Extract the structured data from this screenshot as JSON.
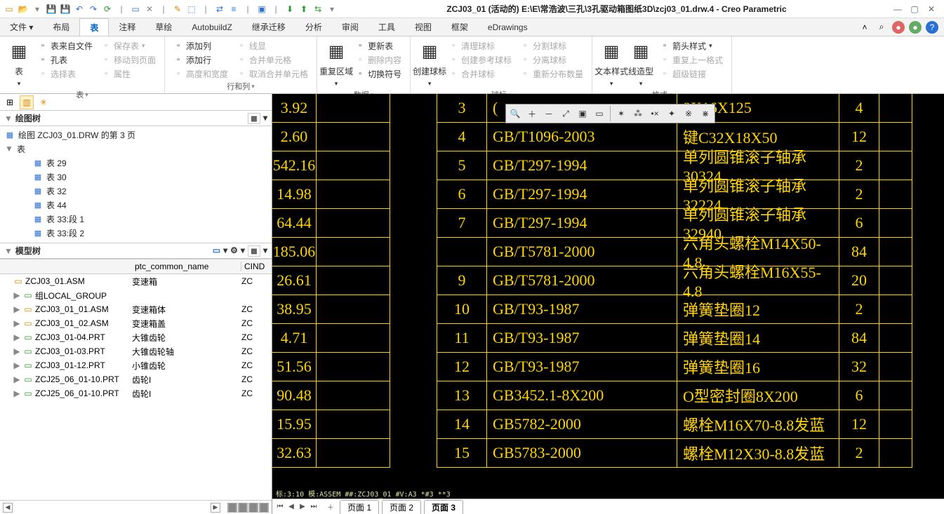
{
  "app_title": "ZCJ03_01 (活动的) E:\\E\\常浩波\\三孔\\3孔驱动箱图纸3D\\zcj03_01.drw.4 - Creo Parametric",
  "menus": [
    "文件",
    "布局",
    "表",
    "注释",
    "草绘",
    "AutobuildZ",
    "继承迁移",
    "分析",
    "审阅",
    "工具",
    "视图",
    "框架",
    "eDrawings"
  ],
  "active_menu_index": 2,
  "ribbon": {
    "groups": [
      {
        "label": "表",
        "items": [
          {
            "t": "表",
            "big": true
          },
          {
            "t": "表来自文件"
          },
          {
            "t": "孔表"
          },
          {
            "t": "选择表",
            "disabled": true
          },
          {
            "t": "保存表",
            "dd": true,
            "disabled": true
          },
          {
            "t": "移动到页面",
            "disabled": true
          },
          {
            "t": "属性",
            "disabled": true
          }
        ]
      },
      {
        "label": "行和列",
        "items": [
          {
            "t": "添加列"
          },
          {
            "t": "添加行"
          },
          {
            "t": "高度和宽度",
            "disabled": true
          },
          {
            "t": "线显",
            "disabled": true
          },
          {
            "t": "合并单元格",
            "disabled": true
          },
          {
            "t": "取消合并单元格",
            "disabled": true
          }
        ]
      },
      {
        "label": "数据",
        "items": [
          {
            "t": "重复区域",
            "big": true
          },
          {
            "t": "更新表"
          },
          {
            "t": "删除内容",
            "disabled": true
          },
          {
            "t": "切换符号"
          }
        ]
      },
      {
        "label": "球标",
        "items": [
          {
            "t": "创建球标",
            "big": true
          },
          {
            "t": "清理球标",
            "disabled": true
          },
          {
            "t": "创建参考球标",
            "disabled": true
          },
          {
            "t": "合并球标",
            "disabled": true
          },
          {
            "t": "分割球标",
            "disabled": true
          },
          {
            "t": "分离球标",
            "disabled": true
          },
          {
            "t": "重新分布数量",
            "disabled": true
          }
        ]
      },
      {
        "label": "格式",
        "items": [
          {
            "t": "文本样式",
            "big": true
          },
          {
            "t": "线造型",
            "big": true
          },
          {
            "t": "箭头样式",
            "dd": true
          },
          {
            "t": "重复上一格式",
            "disabled": true
          },
          {
            "t": "超级链接",
            "disabled": true
          }
        ]
      }
    ]
  },
  "drawing_tree": {
    "title": "绘图树",
    "root": "绘图 ZCJ03_01.DRW 的第 3 页",
    "nodes": [
      {
        "label": "表",
        "children": [
          {
            "label": "表 29"
          },
          {
            "label": "表 30"
          },
          {
            "label": "表 32"
          },
          {
            "label": "表 44"
          },
          {
            "label": "表 33:段 1"
          },
          {
            "label": "表 33:段 2"
          }
        ]
      }
    ]
  },
  "model_tree": {
    "title": "模型树",
    "columns": [
      "",
      "ptc_common_name",
      "CIND"
    ],
    "rows": [
      {
        "name": "ZCJ03_01.ASM",
        "common": "变速箱",
        "cind": "ZC",
        "expand": ""
      },
      {
        "name": "组LOCAL_GROUP",
        "common": "",
        "cind": "",
        "expand": "▶",
        "indent": 1
      },
      {
        "name": "ZCJ03_01_01.ASM",
        "common": "变速箱体",
        "cind": "ZC",
        "expand": "▶",
        "indent": 1
      },
      {
        "name": "ZCJ03_01_02.ASM",
        "common": "变速箱盖",
        "cind": "ZC",
        "expand": "▶",
        "indent": 1
      },
      {
        "name": "ZCJ03_01-04.PRT",
        "common": "大锥齿轮",
        "cind": "ZC",
        "expand": "▶",
        "indent": 1
      },
      {
        "name": "ZCJ03_01-03.PRT",
        "common": "大锥齿轮轴",
        "cind": "ZC",
        "expand": "▶",
        "indent": 1
      },
      {
        "name": "ZCJ03_01-12.PRT",
        "common": "小锥齿轮",
        "cind": "ZC",
        "expand": "▶",
        "indent": 1
      },
      {
        "name": "ZCJ25_06_01-10.PRT",
        "common": "齿轮I",
        "cind": "ZC",
        "expand": "▶",
        "indent": 1
      },
      {
        "name": "ZCJ25_06_01-10.PRT",
        "common": "齿轮I",
        "cind": "ZC",
        "expand": "▶",
        "indent": 1
      }
    ]
  },
  "left_values": [
    "3.92",
    "2.60",
    "542.16",
    "14.98",
    "64.44",
    "185.06",
    "26.61",
    "38.95",
    "4.71",
    "51.56",
    "90.48",
    "15.95",
    "32.63"
  ],
  "bom_rows": [
    {
      "n": "3",
      "std": "(",
      "desc": "8X16X125",
      "qty": "4"
    },
    {
      "n": "4",
      "std": "GB/T1096-2003",
      "desc": "键C32X18X50",
      "qty": "12"
    },
    {
      "n": "5",
      "std": "GB/T297-1994",
      "desc": "单列圆锥滚子轴承30324",
      "qty": "2"
    },
    {
      "n": "6",
      "std": "GB/T297-1994",
      "desc": "单列圆锥滚子轴承32224",
      "qty": "2"
    },
    {
      "n": "7",
      "std": "GB/T297-1994",
      "desc": "单列圆锥滚子轴承32940",
      "qty": "6"
    },
    {
      "n": "",
      "std": "GB/T5781-2000",
      "desc": "六角头螺栓M14X50-4.8",
      "qty": "84"
    },
    {
      "n": "9",
      "std": "GB/T5781-2000",
      "desc": "六角头螺栓M16X55-4.8",
      "qty": "20"
    },
    {
      "n": "10",
      "std": "GB/T93-1987",
      "desc": "弹簧垫圈12",
      "qty": "2"
    },
    {
      "n": "11",
      "std": "GB/T93-1987",
      "desc": "弹簧垫圈14",
      "qty": "84"
    },
    {
      "n": "12",
      "std": "GB/T93-1987",
      "desc": "弹簧垫圈16",
      "qty": "32"
    },
    {
      "n": "13",
      "std": "GB3452.1-8X200",
      "desc": "O型密封圈8X200",
      "qty": "6"
    },
    {
      "n": "14",
      "std": "GB5782-2000",
      "desc": "螺栓M16X70-8.8发蓝",
      "qty": "12"
    },
    {
      "n": "15",
      "std": "GB5783-2000",
      "desc": "螺栓M12X30-8.8发蓝",
      "qty": "2"
    }
  ],
  "status_text": "标:3:10   模:ASSEM   ##:ZCJ03_01   #V:A3   *#3 **3",
  "page_tabs": [
    "页面 1",
    "页面 2",
    "页面 3"
  ],
  "active_page": 2
}
